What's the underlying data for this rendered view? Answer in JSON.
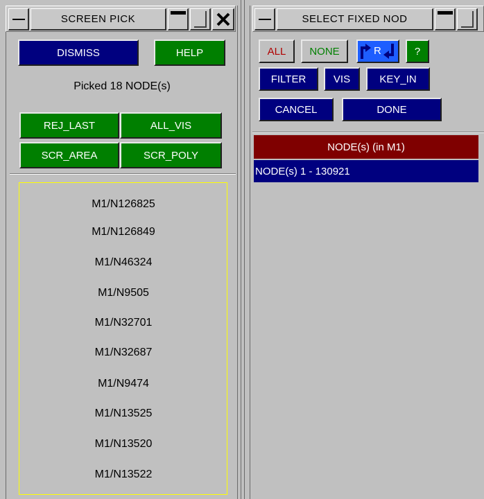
{
  "screen_pick": {
    "title": "SCREEN PICK",
    "dismiss_label": "DISMISS",
    "help_label": "HELP",
    "status": "Picked 18 NODE(s)",
    "rej_last_label": "REJ_LAST",
    "all_vis_label": "ALL_VIS",
    "scr_area_label": "SCR_AREA",
    "scr_poly_label": "SCR_POLY",
    "picked_nodes": [
      "M1/N126825",
      "M1/N126849",
      "M1/N46324",
      "M1/N9505",
      "M1/N32701",
      "M1/N32687",
      "M1/N9474",
      "M1/N13525",
      "M1/N13520",
      "M1/N13522"
    ]
  },
  "select_fixed": {
    "title": "SELECT FIXED NOD",
    "all_label": "ALL",
    "none_label": "NONE",
    "reverse_label": "R",
    "query_label": "?",
    "filter_label": "FILTER",
    "vis_label": "VIS",
    "key_in_label": "KEY_IN",
    "cancel_label": "CANCEL",
    "done_label": "DONE",
    "list_header": "NODE(s) (in M1)",
    "list_item": "NODE(s) 1 - 130921"
  },
  "colors": {
    "panel_gray": "#c0c0c0",
    "button_navy": "#00007f",
    "button_green": "#007f00",
    "header_maroon": "#7f0000",
    "all_red": "#b00000",
    "none_green": "#008000",
    "box_yellow": "#ffff00"
  }
}
